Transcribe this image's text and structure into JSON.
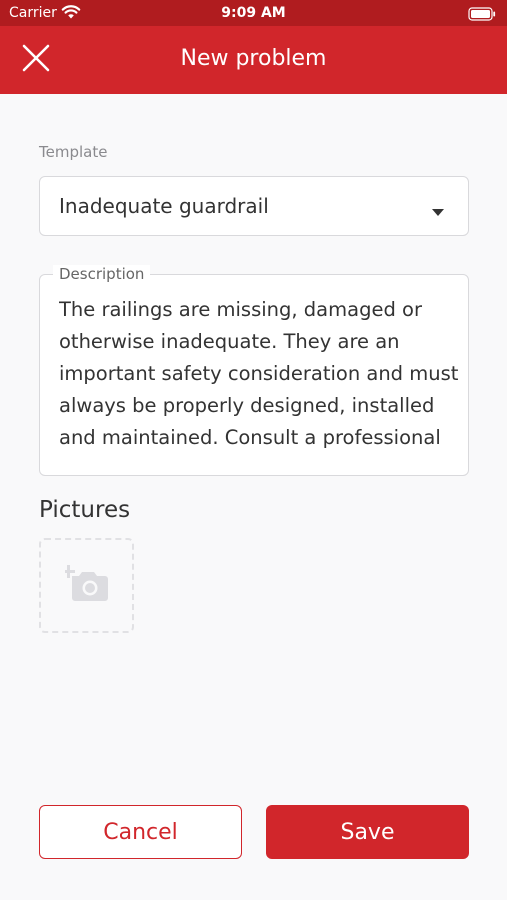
{
  "status_bar": {
    "carrier": "Carrier",
    "time": "9:09 AM"
  },
  "app_bar": {
    "title": "New problem",
    "close_icon": "close-icon"
  },
  "form": {
    "template": {
      "label": "Template",
      "value": "Inadequate guardrail"
    },
    "description": {
      "label": "Description",
      "value": "The railings are missing, damaged or otherwise inadequate. They are an important safety consideration and must always be properly designed, installed and maintained. Consult a professional"
    },
    "pictures": {
      "title": "Pictures",
      "add_icon": "add-photo-icon"
    }
  },
  "actions": {
    "cancel_label": "Cancel",
    "save_label": "Save"
  },
  "colors": {
    "accent": "#d1262b",
    "status_bar": "#b01c1f"
  }
}
